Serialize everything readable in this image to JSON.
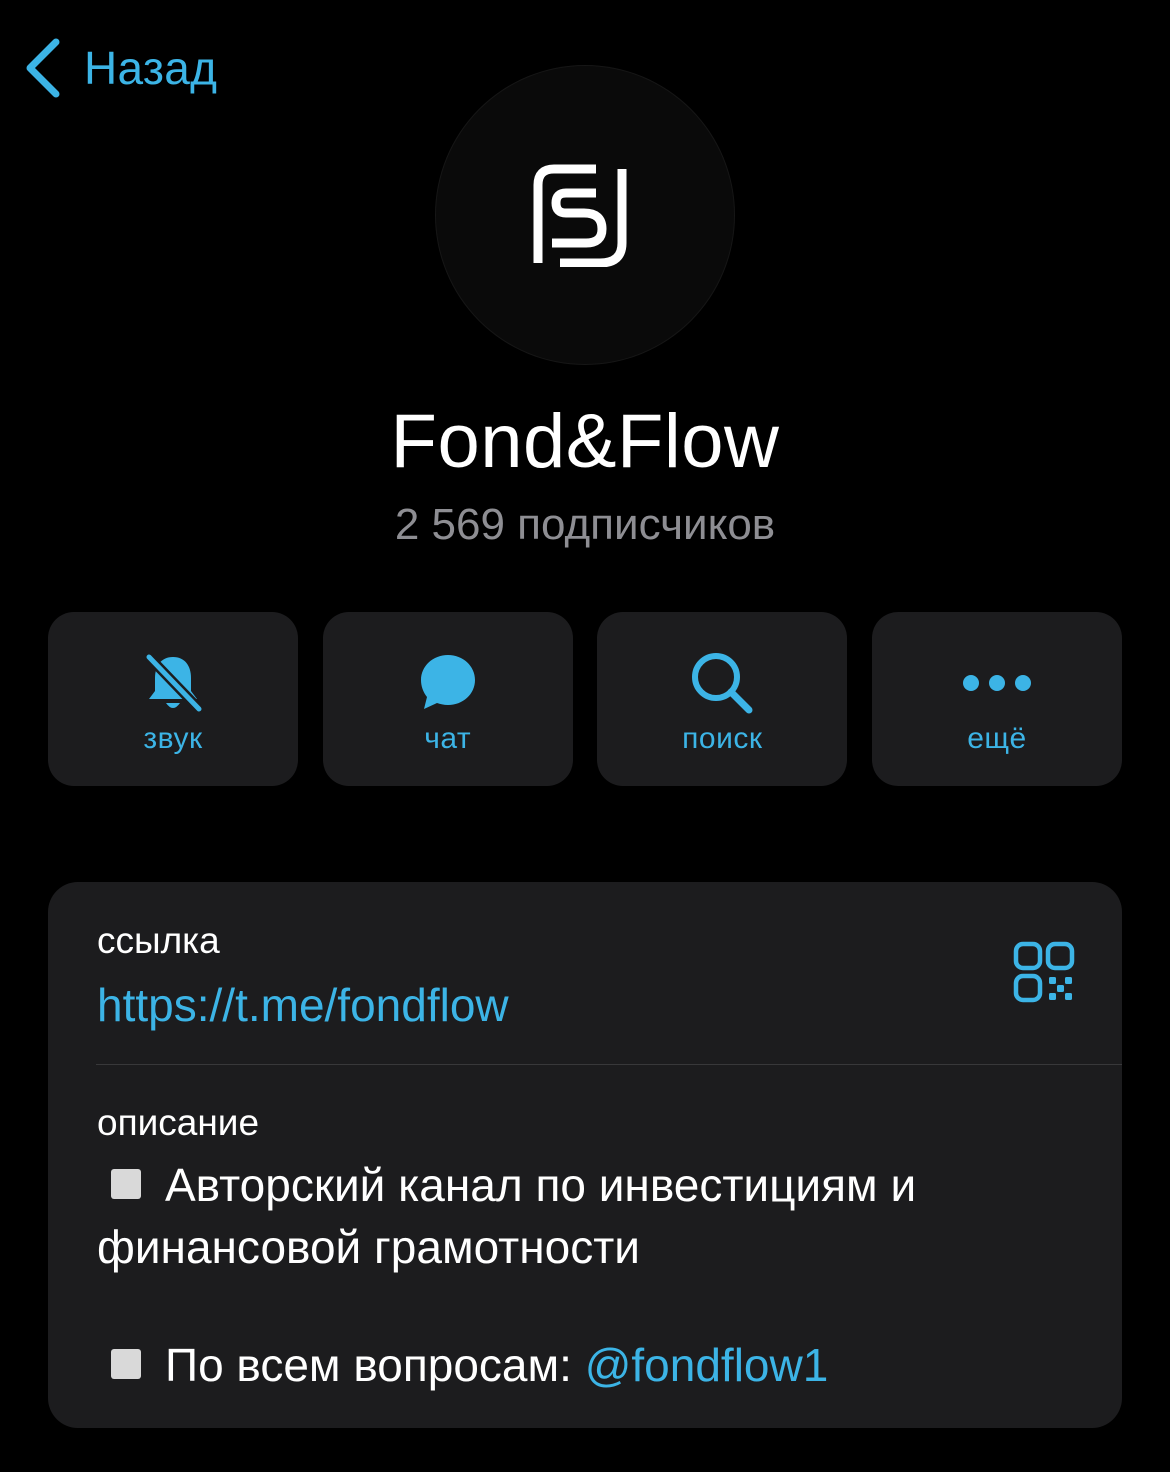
{
  "header": {
    "back_label": "Назад"
  },
  "channel": {
    "logo_icon": "fond-flow-logo",
    "name": "Fond&Flow",
    "subscribers": "2 569 подписчиков"
  },
  "actions": [
    {
      "label": "звук",
      "icon": "bell-slash-icon"
    },
    {
      "label": "чат",
      "icon": "chat-bubble-icon"
    },
    {
      "label": "поиск",
      "icon": "search-icon"
    },
    {
      "label": "ещё",
      "icon": "more-dots-icon"
    }
  ],
  "info": {
    "link_label": "ссылка",
    "link_value": "https://t.me/fondflow",
    "qr_icon": "qr-code-icon",
    "description_label": "описание",
    "description_line1": "Авторский канал по инвестициям и финансовой грамотности",
    "description_line2_prefix": "По всем вопросам: ",
    "description_mention": "@fondflow1"
  },
  "colors": {
    "accent": "#3cb4e6",
    "background": "#000000",
    "card": "#1c1c1e",
    "secondary_text": "#8e8e93"
  }
}
